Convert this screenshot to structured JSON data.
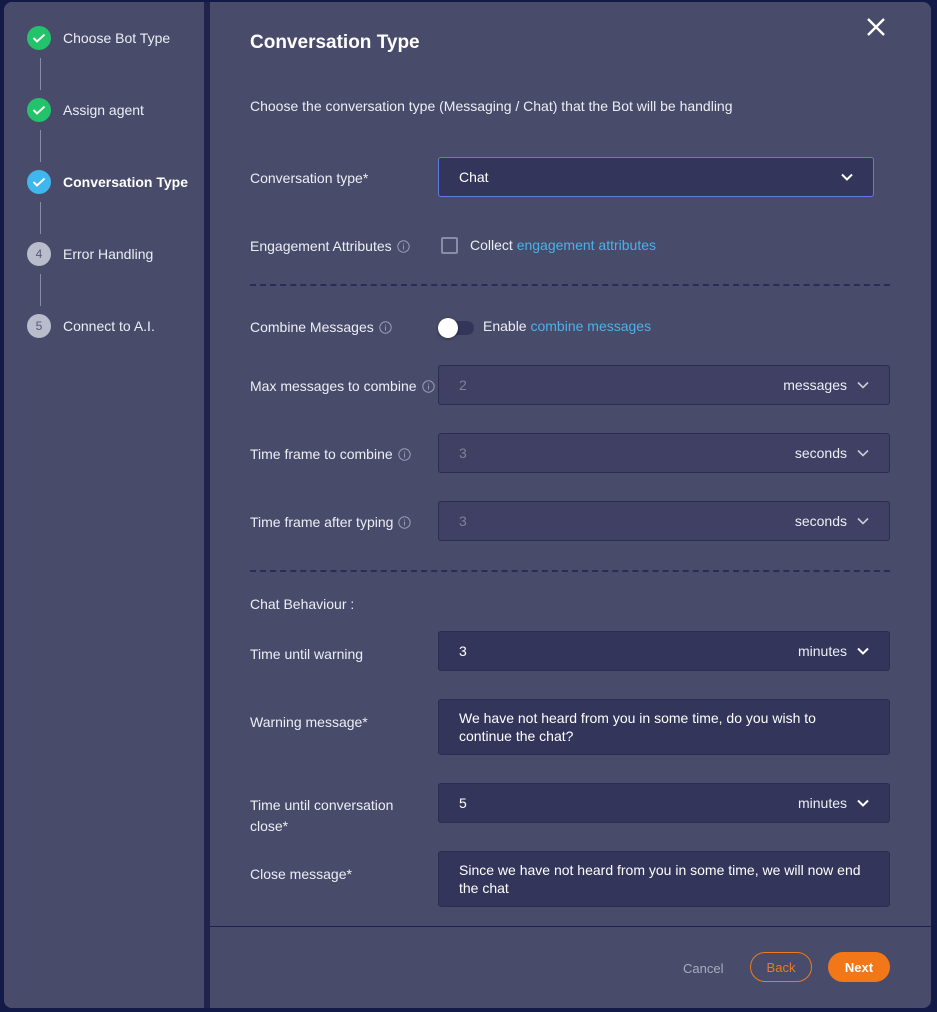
{
  "stepper": {
    "steps": [
      {
        "label": "Choose Bot Type",
        "status": "done",
        "number": "1"
      },
      {
        "label": "Assign agent",
        "status": "done",
        "number": "2"
      },
      {
        "label": "Conversation Type",
        "status": "active",
        "number": "3"
      },
      {
        "label": "Error Handling",
        "status": "pending",
        "number": "4"
      },
      {
        "label": "Connect to A.I.",
        "status": "pending",
        "number": "5"
      }
    ]
  },
  "header": {
    "title": "Conversation Type",
    "subtitle": "Choose the conversation type (Messaging / Chat) that the Bot will be handling"
  },
  "form": {
    "conversation_type": {
      "label": "Conversation type*",
      "value": "Chat"
    },
    "engagement": {
      "label": "Engagement Attributes",
      "checkbox_prefix": "Collect",
      "checkbox_link": "engagement attributes",
      "checked": false
    },
    "combine": {
      "label": "Combine Messages",
      "toggle_prefix": "Enable",
      "toggle_link": "combine messages",
      "enabled": false
    },
    "max_messages": {
      "label": "Max messages to combine",
      "value": "2",
      "unit": "messages"
    },
    "time_frame_combine": {
      "label": "Time frame to combine",
      "value": "3",
      "unit": "seconds"
    },
    "time_frame_typing": {
      "label": "Time frame after typing",
      "value": "3",
      "unit": "seconds"
    },
    "chat_behaviour_heading": "Chat Behaviour :",
    "time_until_warning": {
      "label": "Time until warning",
      "value": "3",
      "unit": "minutes"
    },
    "warning_message": {
      "label": "Warning message*",
      "value": "We have not heard from you in some time, do you wish to continue the chat?"
    },
    "time_until_close": {
      "label_line1": "Time until conversation",
      "label_line2": "close*",
      "value": "5",
      "unit": "minutes"
    },
    "close_message": {
      "label": "Close message*",
      "value": "Since we have not heard from you in some time, we will now end the chat"
    }
  },
  "footer": {
    "cancel": "Cancel",
    "back": "Back",
    "next": "Next"
  },
  "colors": {
    "accent_orange": "#f27718",
    "link_blue": "#48b3e8",
    "done_green": "#22c36a",
    "active_blue": "#3fb6ec"
  }
}
